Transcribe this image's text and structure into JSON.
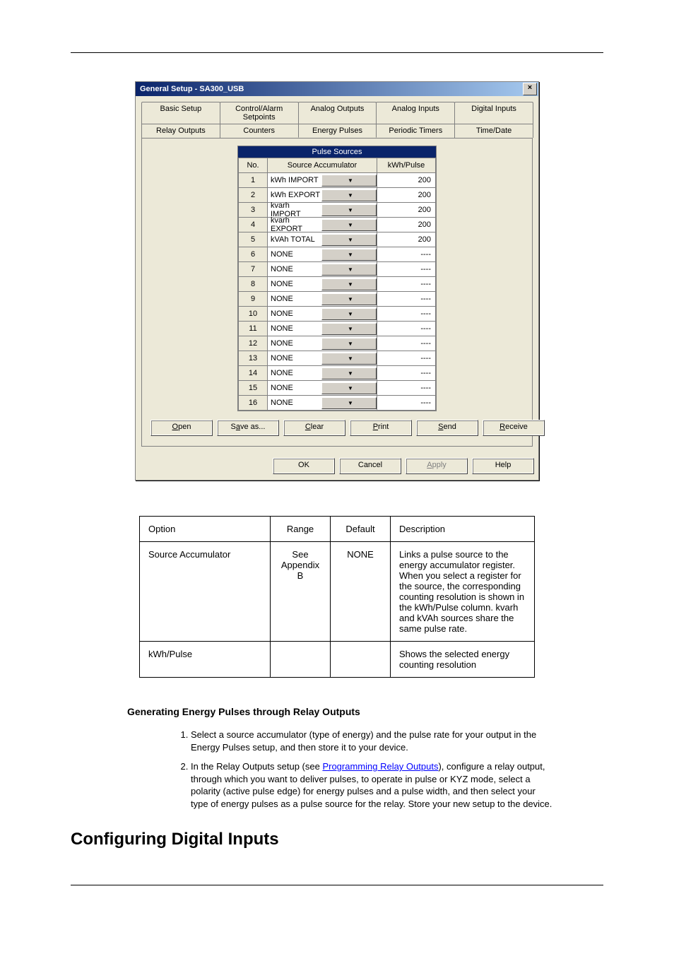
{
  "dialog": {
    "title": "General Setup - SA300_USB",
    "close_glyph": "×",
    "tabs_row1": [
      "Basic Setup",
      "Control/Alarm Setpoints",
      "Analog Outputs",
      "Analog Inputs",
      "Digital Inputs"
    ],
    "tabs_row2": [
      "Relay Outputs",
      "Counters",
      "Energy Pulses",
      "Periodic Timers",
      "Time/Date"
    ],
    "active_tab": "Energy Pulses",
    "inner_title": "Pulse Sources",
    "columns": [
      "No.",
      "Source Accumulator",
      "kWh/Pulse"
    ],
    "rows": [
      {
        "no": "1",
        "src": "kWh IMPORT",
        "kwh": "200"
      },
      {
        "no": "2",
        "src": "kWh EXPORT",
        "kwh": "200"
      },
      {
        "no": "3",
        "src": "kvarh IMPORT",
        "kwh": "200"
      },
      {
        "no": "4",
        "src": "kvarh EXPORT",
        "kwh": "200"
      },
      {
        "no": "5",
        "src": "kVAh TOTAL",
        "kwh": "200"
      },
      {
        "no": "6",
        "src": "NONE",
        "kwh": "----"
      },
      {
        "no": "7",
        "src": "NONE",
        "kwh": "----"
      },
      {
        "no": "8",
        "src": "NONE",
        "kwh": "----"
      },
      {
        "no": "9",
        "src": "NONE",
        "kwh": "----"
      },
      {
        "no": "10",
        "src": "NONE",
        "kwh": "----"
      },
      {
        "no": "11",
        "src": "NONE",
        "kwh": "----"
      },
      {
        "no": "12",
        "src": "NONE",
        "kwh": "----"
      },
      {
        "no": "13",
        "src": "NONE",
        "kwh": "----"
      },
      {
        "no": "14",
        "src": "NONE",
        "kwh": "----"
      },
      {
        "no": "15",
        "src": "NONE",
        "kwh": "----"
      },
      {
        "no": "16",
        "src": "NONE",
        "kwh": "----"
      }
    ],
    "buttons_inner": {
      "open": "Open",
      "save": "Save as...",
      "clear": "Clear",
      "print": "Print",
      "send": "Send",
      "receive": "Receive"
    },
    "buttons_bottom": {
      "ok": "OK",
      "cancel": "Cancel",
      "apply": "Apply",
      "help": "Help"
    },
    "hotkeys": {
      "open": "O",
      "save": "a",
      "clear": "C",
      "print": "P",
      "send": "S",
      "receive": "R",
      "apply": "A"
    }
  },
  "doc_table": {
    "head": [
      "Option",
      "Range",
      "Default",
      "Description"
    ],
    "rows": [
      {
        "c1": "Source Accumulator",
        "c2": "See Appendix B",
        "c3": "NONE",
        "c4": "Links a pulse source to the energy accumulator register. When you select a register for the source, the corresponding counting resolution is shown in the kWh/Pulse column. kvarh and kVAh sources share the same pulse rate."
      },
      {
        "c1": "kWh/Pulse",
        "c2": "",
        "c3": "",
        "c4": "Shows the selected energy counting resolution"
      }
    ]
  },
  "subhead": "Generating Energy Pulses through Relay Outputs",
  "steps": {
    "s1": "Select a source accumulator (type of energy) and the pulse rate for your output in the Energy Pulses setup, and then store it to your device.",
    "s2a": "In the Relay Outputs setup (see ",
    "s2link": "Programming Relay Outputs",
    "s2b": "), configure a relay output, through which you want to deliver pulses, to operate in pulse or KYZ mode, select a polarity (active pulse edge) for energy pulses and a pulse width, and then select your type of energy pulses as a pulse source for the relay. Store your new setup to the device."
  },
  "section_heading": "Configuring Digital Inputs"
}
